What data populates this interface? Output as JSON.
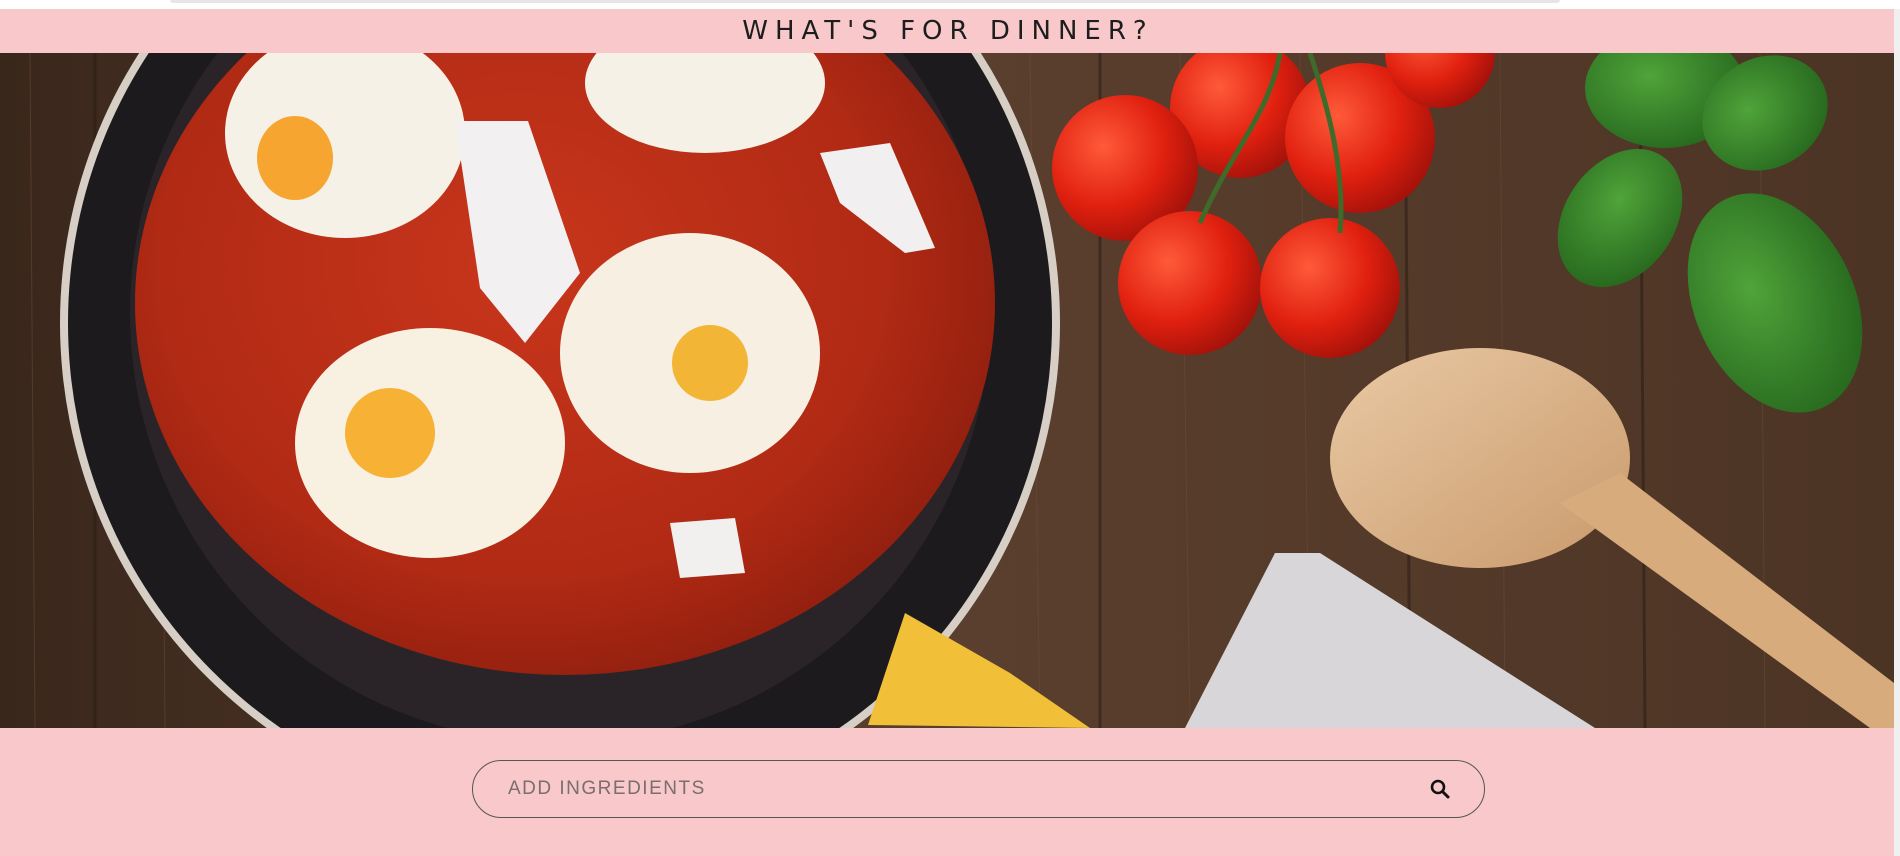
{
  "header": {
    "title": "WHAT'S FOR DINNER?"
  },
  "hero": {
    "image_description_icon": "food-hero-image"
  },
  "search": {
    "placeholder": "ADD INGREDIENTS",
    "value": "",
    "icon": "search-icon"
  },
  "colors": {
    "background": "#f8c8ca",
    "title": "#1d1d1d",
    "border": "#555555"
  }
}
